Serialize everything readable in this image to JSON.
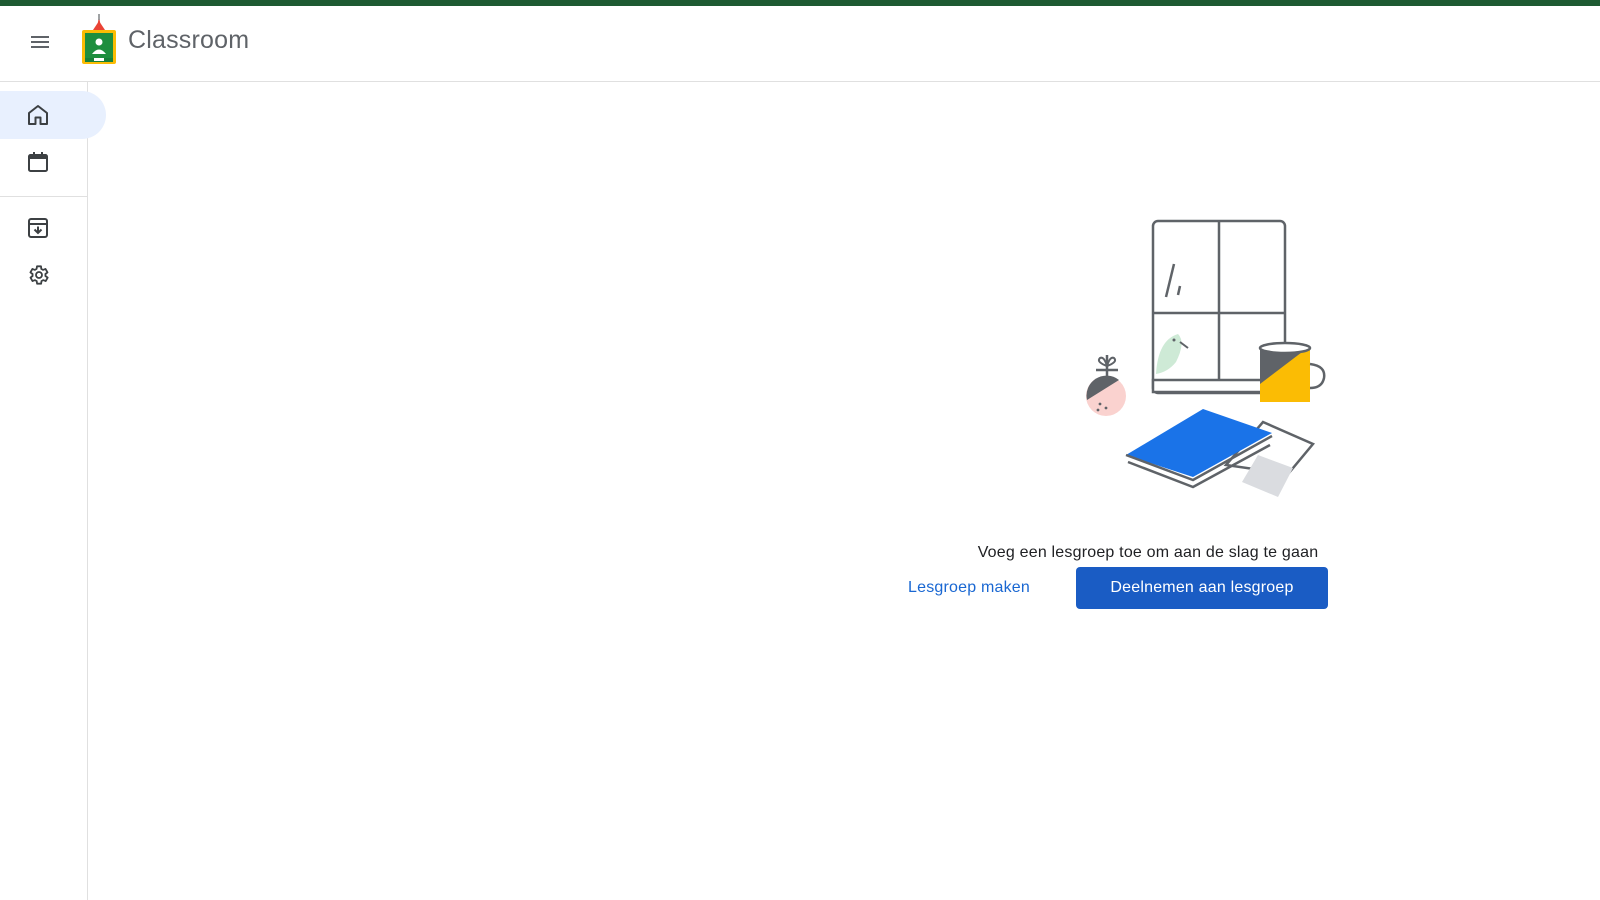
{
  "app": {
    "title": "Classroom"
  },
  "header": {
    "menu_icon": "hamburger-menu-icon",
    "logo_icon": "classroom-logo"
  },
  "sidebar": {
    "items": [
      {
        "name": "home",
        "icon": "home-icon",
        "active": true
      },
      {
        "name": "calendar",
        "icon": "calendar-icon",
        "active": false
      },
      {
        "name": "archived",
        "icon": "archive-icon",
        "active": false
      },
      {
        "name": "settings",
        "icon": "gear-icon",
        "active": false
      }
    ]
  },
  "main": {
    "empty_message": "Voeg een lesgroep toe om aan de slag te gaan",
    "create_label": "Lesgroep maken",
    "join_label": "Deelnemen aan lesgroep"
  },
  "colors": {
    "top_stripe": "#1e5a32",
    "primary": "#1a5cc4",
    "link": "#1967d2",
    "active_nav_bg": "#e8f0fe",
    "logo_green": "#1e8e3e",
    "logo_yellow": "#fbbc04",
    "book_blue": "#1a73e8",
    "mug_yellow": "#fbbc04"
  }
}
